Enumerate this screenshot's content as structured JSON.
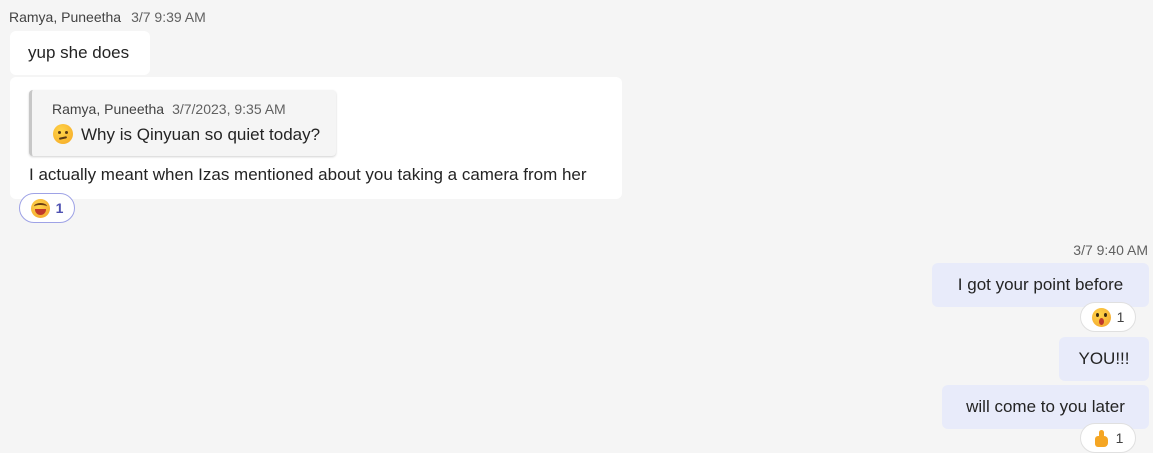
{
  "incoming": {
    "sender": "Ramya, Puneetha",
    "time": "3/7 9:39 AM",
    "message1": "yup she does",
    "quote": {
      "sender": "Ramya, Puneetha",
      "time": "3/7/2023, 9:35 AM",
      "emoji": "thinking-face",
      "text": "Why is Qinyuan so quiet today?"
    },
    "message2": "I actually meant when Izas mentioned about you taking a camera from her",
    "reaction": {
      "emoji": "laughing-face",
      "count": "1"
    }
  },
  "outgoing": {
    "time": "3/7 9:40 AM",
    "messages": [
      {
        "text": "I got your point before",
        "reaction": {
          "emoji": "surprised-face",
          "count": "1"
        }
      },
      {
        "text": "YOU!!!"
      },
      {
        "text": "will come to you later",
        "reaction": {
          "emoji": "thumbs-up",
          "count": "1"
        }
      }
    ]
  },
  "colors": {
    "background": "#f5f5f5",
    "incoming_bubble": "#ffffff",
    "outgoing_bubble": "#e8ebfa",
    "reaction_accent": "#4f52b2"
  }
}
